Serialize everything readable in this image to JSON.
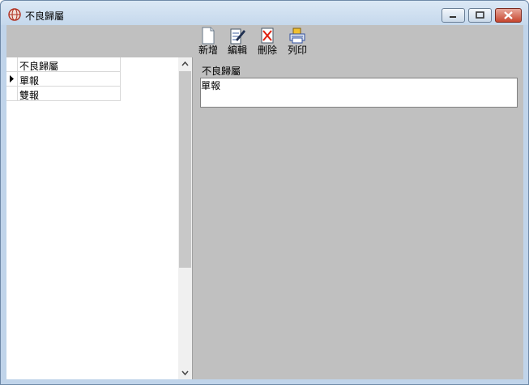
{
  "window": {
    "title": "不良歸屬"
  },
  "toolbar": {
    "buttons": [
      {
        "label": "新增",
        "icon": "new-document-icon"
      },
      {
        "label": "編輯",
        "icon": "edit-document-icon"
      },
      {
        "label": "刪除",
        "icon": "delete-icon"
      },
      {
        "label": "列印",
        "icon": "printer-icon"
      }
    ]
  },
  "grid": {
    "header": "不良歸屬",
    "rows": [
      "單報",
      "雙報"
    ],
    "selected_row": 0
  },
  "detail": {
    "label": "不良歸屬",
    "value": "單報"
  },
  "colors": {
    "panel": "#c0c0c0",
    "titlebar": "#c5d8ec"
  }
}
